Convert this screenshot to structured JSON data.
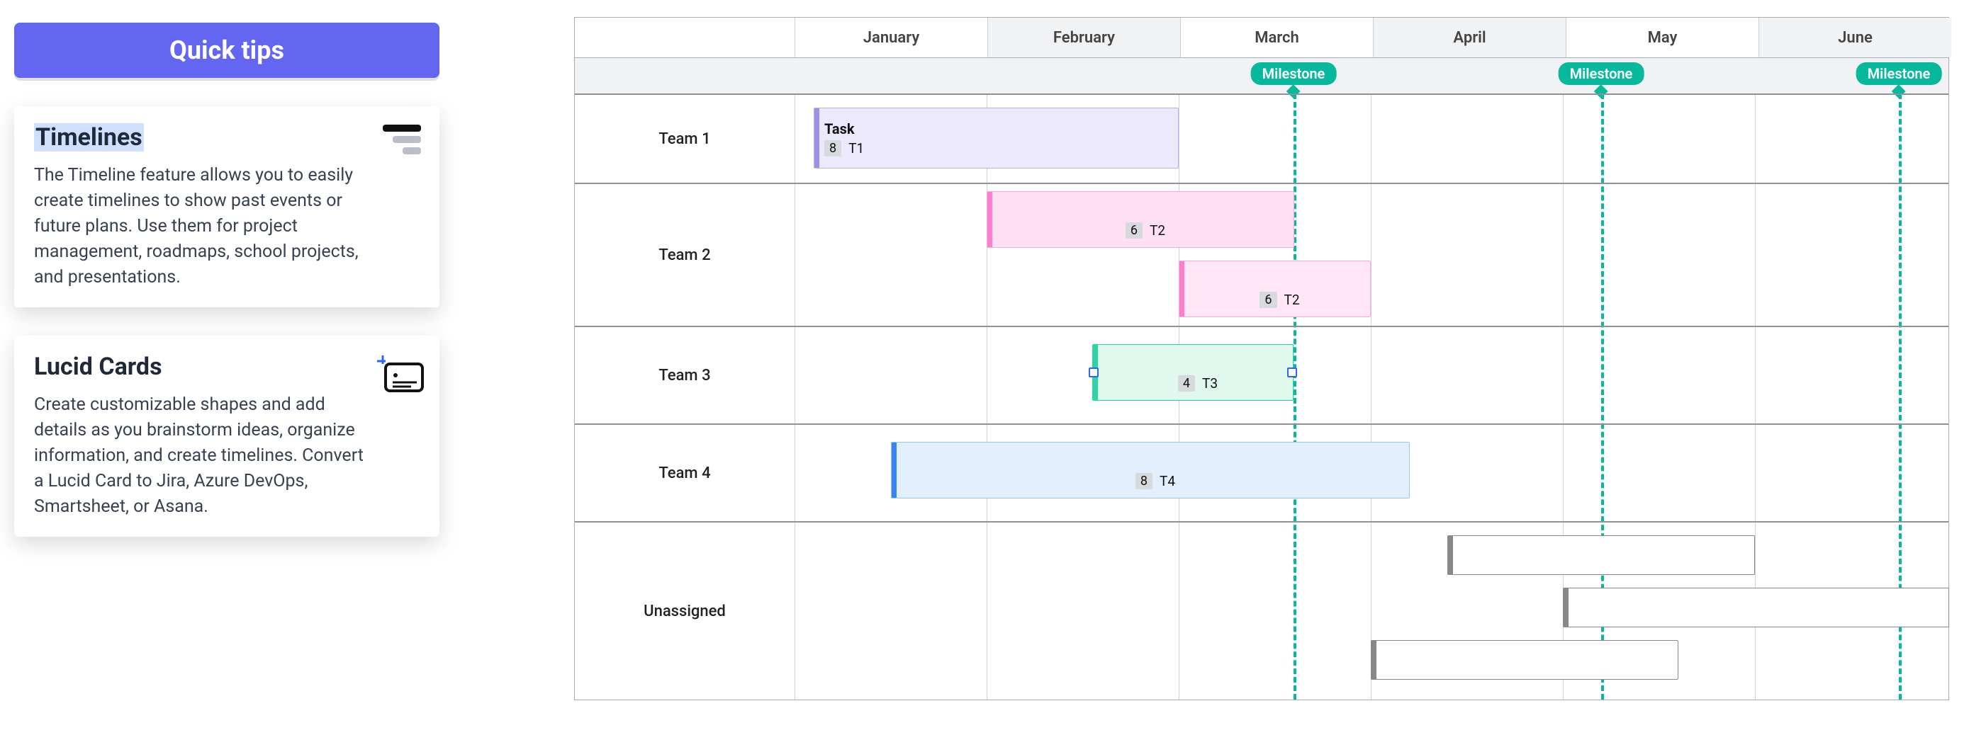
{
  "tips": {
    "header": "Quick tips",
    "cards": [
      {
        "title": "Timelines",
        "body": "The Timeline feature allows you to easily create timelines to show past events or future plans. Use them for project management, roadmaps, school projects, and presentations."
      },
      {
        "title": "Lucid Cards",
        "body": "Create customizable shapes and add details as you brainstorm ideas, organize information, and create timelines. Convert a Lucid Card to Jira, Azure DevOps, Smartsheet, or Asana."
      }
    ]
  },
  "timeline": {
    "months": [
      {
        "label": "January",
        "shaded": false
      },
      {
        "label": "February",
        "shaded": true
      },
      {
        "label": "March",
        "shaded": false
      },
      {
        "label": "April",
        "shaded": true
      },
      {
        "label": "May",
        "shaded": false
      },
      {
        "label": "June",
        "shaded": true
      }
    ],
    "milestones": [
      {
        "label": "Milestone",
        "month_index": 2.6
      },
      {
        "label": "Milestone",
        "month_index": 4.2
      },
      {
        "label": "Milestone",
        "month_index": 5.75
      }
    ],
    "lanes": [
      {
        "label": "Team 1"
      },
      {
        "label": "Team 2"
      },
      {
        "label": "Team 3"
      },
      {
        "label": "Team 4"
      },
      {
        "label": "Unassigned"
      }
    ],
    "bars": {
      "team1_task": {
        "title": "Task",
        "badge": "8",
        "tag": "T1"
      },
      "team2_bar1": {
        "badge": "6",
        "tag": "T2"
      },
      "team2_bar2": {
        "badge": "6",
        "tag": "T2"
      },
      "team3_bar": {
        "badge": "4",
        "tag": "T3"
      },
      "team4_bar": {
        "badge": "8",
        "tag": "T4"
      }
    }
  },
  "chart_data": {
    "type": "gantt",
    "x_unit": "month",
    "categories": [
      "January",
      "February",
      "March",
      "April",
      "May",
      "June"
    ],
    "milestones": [
      {
        "label": "Milestone",
        "position": 2.6
      },
      {
        "label": "Milestone",
        "position": 4.2
      },
      {
        "label": "Milestone",
        "position": 5.75
      }
    ],
    "lanes": [
      {
        "name": "Team 1",
        "bars": [
          {
            "title": "Task",
            "badge": 8,
            "tag": "T1",
            "start": 0.1,
            "end": 2.0,
            "color": "#ebe9fb",
            "edge": "#9b92e6"
          }
        ]
      },
      {
        "name": "Team 2",
        "bars": [
          {
            "badge": 6,
            "tag": "T2",
            "start": 1.0,
            "end": 2.6,
            "color": "#ffe0f2",
            "edge": "#ff7fcf"
          },
          {
            "badge": 6,
            "tag": "T2",
            "start": 2.0,
            "end": 3.0,
            "color": "#ffe7f5",
            "edge": "#ff7fcf"
          }
        ]
      },
      {
        "name": "Team 3",
        "bars": [
          {
            "badge": 4,
            "tag": "T3",
            "start": 1.55,
            "end": 2.6,
            "color": "#e0f8ee",
            "edge": "#2dd4a6",
            "selected": true
          }
        ]
      },
      {
        "name": "Team 4",
        "bars": [
          {
            "badge": 8,
            "tag": "T4",
            "start": 0.5,
            "end": 3.2,
            "color": "#e1eefb",
            "edge": "#3b82f6"
          }
        ]
      },
      {
        "name": "Unassigned",
        "bars": [
          {
            "start": 3.4,
            "end": 5.0,
            "color": "#ffffff",
            "edge": "#888"
          },
          {
            "start": 4.0,
            "end": 6.1,
            "color": "#ffffff",
            "edge": "#888"
          },
          {
            "start": 3.0,
            "end": 4.6,
            "color": "#ffffff",
            "edge": "#888"
          }
        ]
      }
    ]
  }
}
